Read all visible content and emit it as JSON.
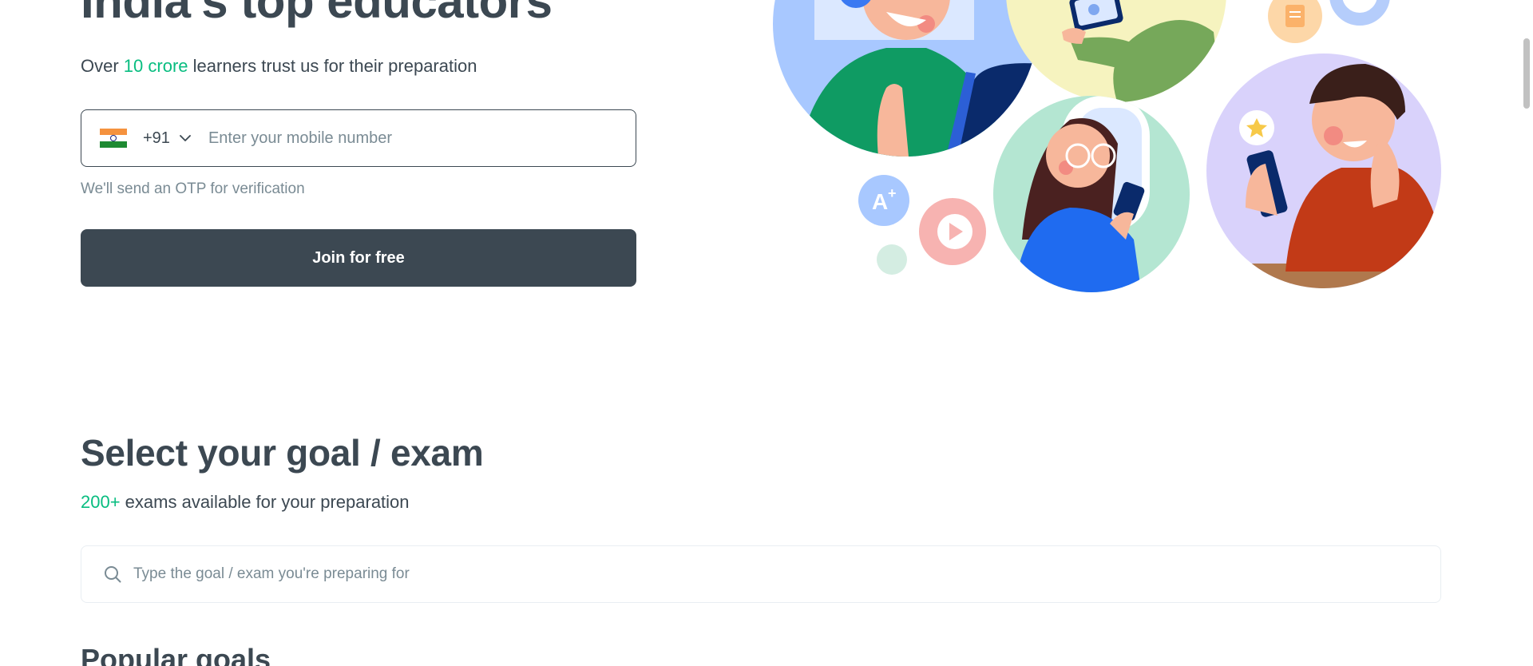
{
  "hero": {
    "title": "India's top educators",
    "subtitle_prefix": "Over ",
    "subtitle_highlight": "10 crore",
    "subtitle_suffix": " learners trust us for their preparation"
  },
  "phone": {
    "country_code": "+91",
    "placeholder": "Enter your mobile number",
    "otp_note": "We'll send an OTP for verification",
    "join_label": "Join for free"
  },
  "goals": {
    "title": "Select your goal / exam",
    "count_highlight": "200+",
    "count_suffix": " exams available for your preparation",
    "search_placeholder": "Type the goal / exam you're preparing for",
    "popular_title": "Popular goals"
  },
  "colors": {
    "accent": "#08bd80",
    "text": "#3c4852",
    "muted": "#7a8b94",
    "button": "#3c4852"
  },
  "icons": [
    "india-flag-icon",
    "chevron-down-icon",
    "search-icon",
    "a-plus-badge-icon",
    "play-icon",
    "star-icon",
    "document-icon"
  ]
}
